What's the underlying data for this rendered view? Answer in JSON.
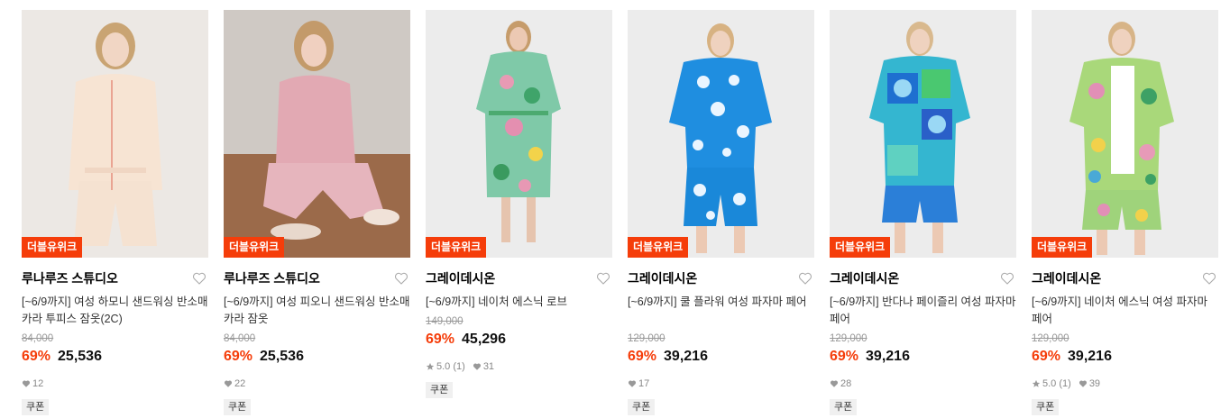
{
  "colors": {
    "accent": "#f53d0a",
    "muted": "#999999",
    "heart": "#aaaaaa"
  },
  "products": [
    {
      "badge": "더블유위크",
      "brand": "루나루즈 스튜디오",
      "title": "[~6/9까지] 여성 하모니 샌드워싱 반소매 카라 투피스 잠옷(2C)",
      "original_price": "84,000",
      "discount": "69%",
      "price": "25,536",
      "rating": "",
      "review_count": "",
      "likes": "12",
      "coupon": "쿠폰",
      "icon": "heart-outline-icon"
    },
    {
      "badge": "더블유위크",
      "brand": "루나루즈 스튜디오",
      "title": "[~6/9까지] 여성 피오니 샌드워싱 반소매 카라 잠옷",
      "original_price": "84,000",
      "discount": "69%",
      "price": "25,536",
      "rating": "",
      "review_count": "",
      "likes": "22",
      "coupon": "쿠폰",
      "icon": "heart-outline-icon"
    },
    {
      "badge": "더블유위크",
      "brand": "그레이데시온",
      "title": "[~6/9까지] 네이처 에스닉 로브",
      "original_price": "149,000",
      "discount": "69%",
      "price": "45,296",
      "rating": "5.0",
      "review_count": "(1)",
      "likes": "31",
      "coupon": "쿠폰",
      "icon": "heart-outline-icon"
    },
    {
      "badge": "더블유위크",
      "brand": "그레이데시온",
      "title": "[~6/9까지] 쿨 플라워 여성 파자마 페어",
      "original_price": "129,000",
      "discount": "69%",
      "price": "39,216",
      "rating": "",
      "review_count": "",
      "likes": "17",
      "coupon": "쿠폰",
      "icon": "heart-outline-icon"
    },
    {
      "badge": "더블유위크",
      "brand": "그레이데시온",
      "title": "[~6/9까지] 반다나 페이즐리 여성 파자마 페어",
      "original_price": "129,000",
      "discount": "69%",
      "price": "39,216",
      "rating": "",
      "review_count": "",
      "likes": "28",
      "coupon": "쿠폰",
      "icon": "heart-outline-icon"
    },
    {
      "badge": "더블유위크",
      "brand": "그레이데시온",
      "title": "[~6/9까지] 네이처 에스닉 여성 파자마 페어",
      "original_price": "129,000",
      "discount": "69%",
      "price": "39,216",
      "rating": "5.0",
      "review_count": "(1)",
      "likes": "39",
      "coupon": "쿠폰",
      "icon": "heart-outline-icon"
    }
  ]
}
